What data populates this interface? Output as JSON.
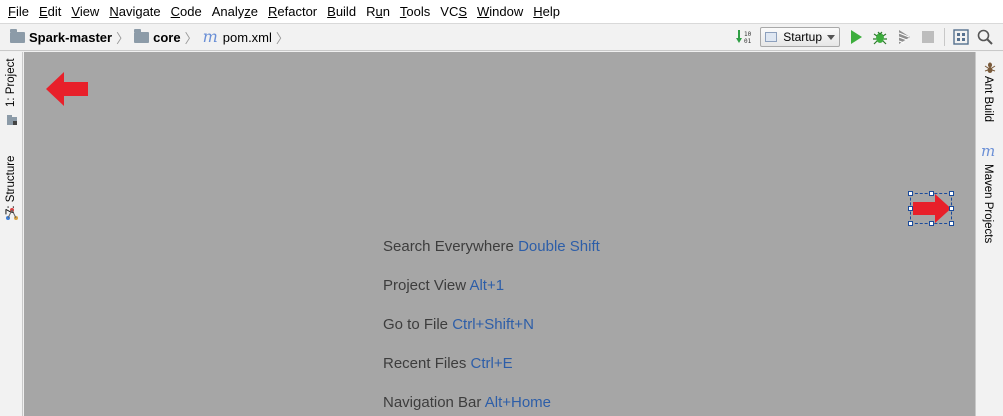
{
  "menu": [
    {
      "pre": "",
      "u": "F",
      "post": "ile"
    },
    {
      "pre": "",
      "u": "E",
      "post": "dit"
    },
    {
      "pre": "",
      "u": "V",
      "post": "iew"
    },
    {
      "pre": "",
      "u": "N",
      "post": "avigate"
    },
    {
      "pre": "",
      "u": "C",
      "post": "ode"
    },
    {
      "pre": "Analy",
      "u": "z",
      "post": "e"
    },
    {
      "pre": "",
      "u": "R",
      "post": "efactor"
    },
    {
      "pre": "",
      "u": "B",
      "post": "uild"
    },
    {
      "pre": "R",
      "u": "u",
      "post": "n"
    },
    {
      "pre": "",
      "u": "T",
      "post": "ools"
    },
    {
      "pre": "VC",
      "u": "S",
      "post": ""
    },
    {
      "pre": "",
      "u": "W",
      "post": "indow"
    },
    {
      "pre": "",
      "u": "H",
      "post": "elp"
    }
  ],
  "breadcrumb": {
    "project": "Spark-master",
    "module": "core",
    "file": "pom.xml"
  },
  "toolbar": {
    "run_config": "Startup"
  },
  "left_tabs": {
    "project": "1: Project",
    "structure": "7: Structure"
  },
  "right_tabs": {
    "ant": "Ant Build",
    "maven": "Maven Projects"
  },
  "hints": [
    {
      "label": "Search Everywhere",
      "key": "Double Shift"
    },
    {
      "label": "Project View",
      "key": "Alt+1"
    },
    {
      "label": "Go to File",
      "key": "Ctrl+Shift+N"
    },
    {
      "label": "Recent Files",
      "key": "Ctrl+E"
    },
    {
      "label": "Navigation Bar",
      "key": "Alt+Home"
    }
  ],
  "colors": {
    "editor_bg": "#a6a6a6",
    "hint_key": "#2d5ea8",
    "annotation_arrow": "#e8202a",
    "run_green": "#3dae3d"
  }
}
